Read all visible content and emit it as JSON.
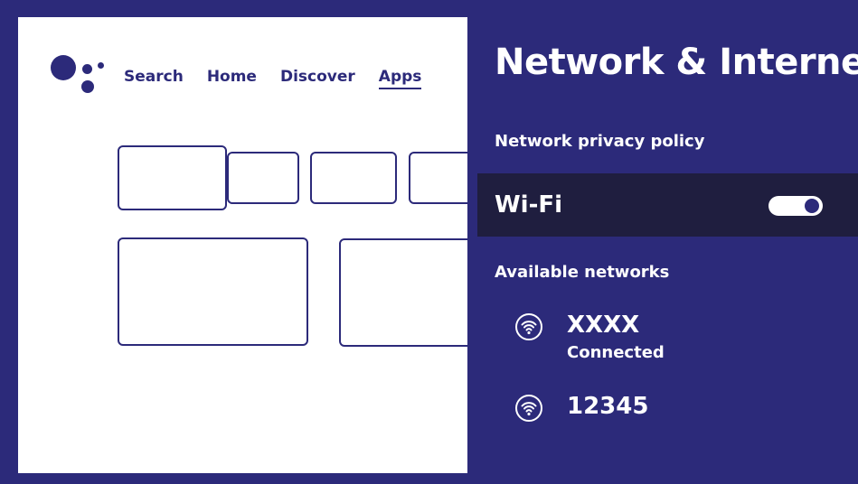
{
  "launcher": {
    "nav": [
      {
        "label": "Search"
      },
      {
        "label": "Home"
      },
      {
        "label": "Discover"
      },
      {
        "label": "Apps",
        "active": true
      }
    ]
  },
  "settings": {
    "title": "Network & Internet",
    "privacy_policy_label": "Network privacy policy",
    "wifi": {
      "label": "Wi-Fi",
      "enabled": true
    },
    "available_networks_label": "Available networks",
    "networks": [
      {
        "name": "XXXX",
        "status": "Connected",
        "icon": "wifi-icon"
      },
      {
        "name": "12345",
        "status": "",
        "icon": "wifi-icon"
      }
    ]
  },
  "colors": {
    "accent": "#2c2a7a",
    "selected_row": "#1f1e3f",
    "background_tv": "#ffffff"
  }
}
